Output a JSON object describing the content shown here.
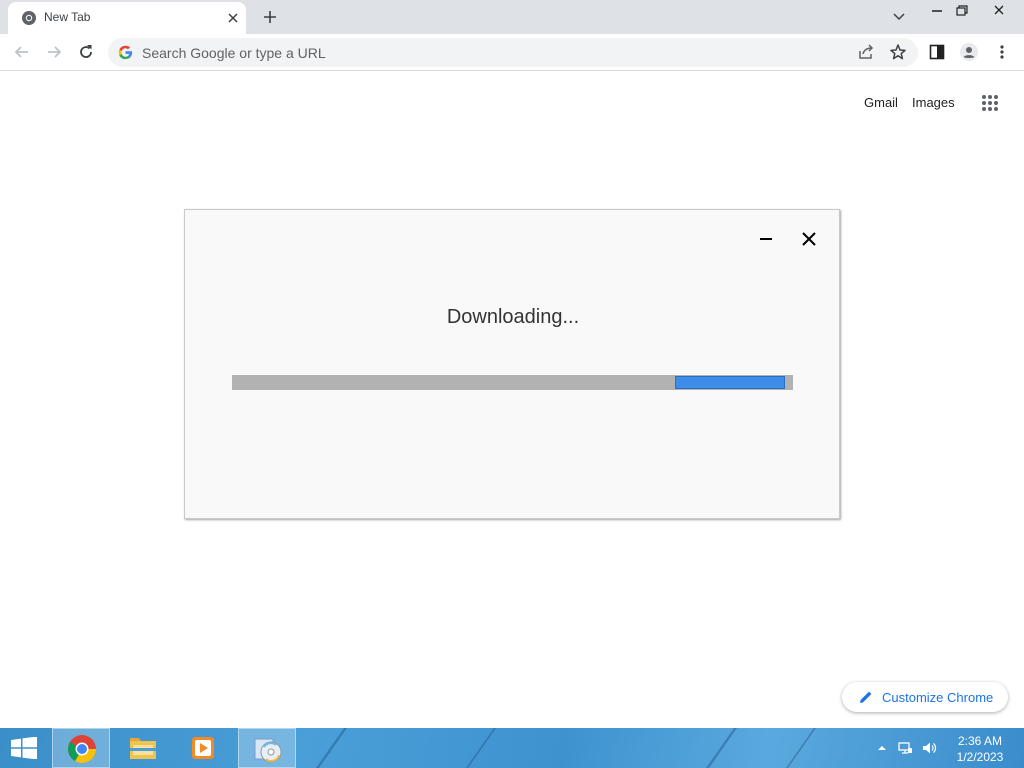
{
  "browser": {
    "tab": {
      "title": "New Tab",
      "favicon": "chrome-icon"
    },
    "omnibox": {
      "placeholder": "Search Google or type a URL"
    },
    "toolbar_icons": [
      "back-icon",
      "forward-icon",
      "reload-icon",
      "share-icon",
      "star-icon",
      "side-panel-icon",
      "profile-icon",
      "menu-icon"
    ],
    "window_controls": [
      "chevron-down-icon",
      "minimize-icon",
      "restore-icon",
      "close-icon"
    ]
  },
  "ntp": {
    "links": {
      "gmail": "Gmail",
      "images": "Images"
    },
    "customize_label": "Customize Chrome"
  },
  "dialog": {
    "title": "Downloading...",
    "progress": {
      "start_fraction": 0.79,
      "end_fraction": 0.985
    },
    "colors": {
      "fill": "#3e8ee9",
      "track": "#b2b2b2"
    }
  },
  "taskbar": {
    "apps": [
      "chrome-icon",
      "file-explorer-icon",
      "media-player-icon",
      "setup-disc-icon"
    ],
    "active_app": "setup-disc-icon",
    "tray_icons": [
      "tray-expand-icon",
      "network-icon",
      "volume-icon"
    ],
    "clock": {
      "time": "2:36 AM",
      "date": "1/2/2023"
    }
  }
}
